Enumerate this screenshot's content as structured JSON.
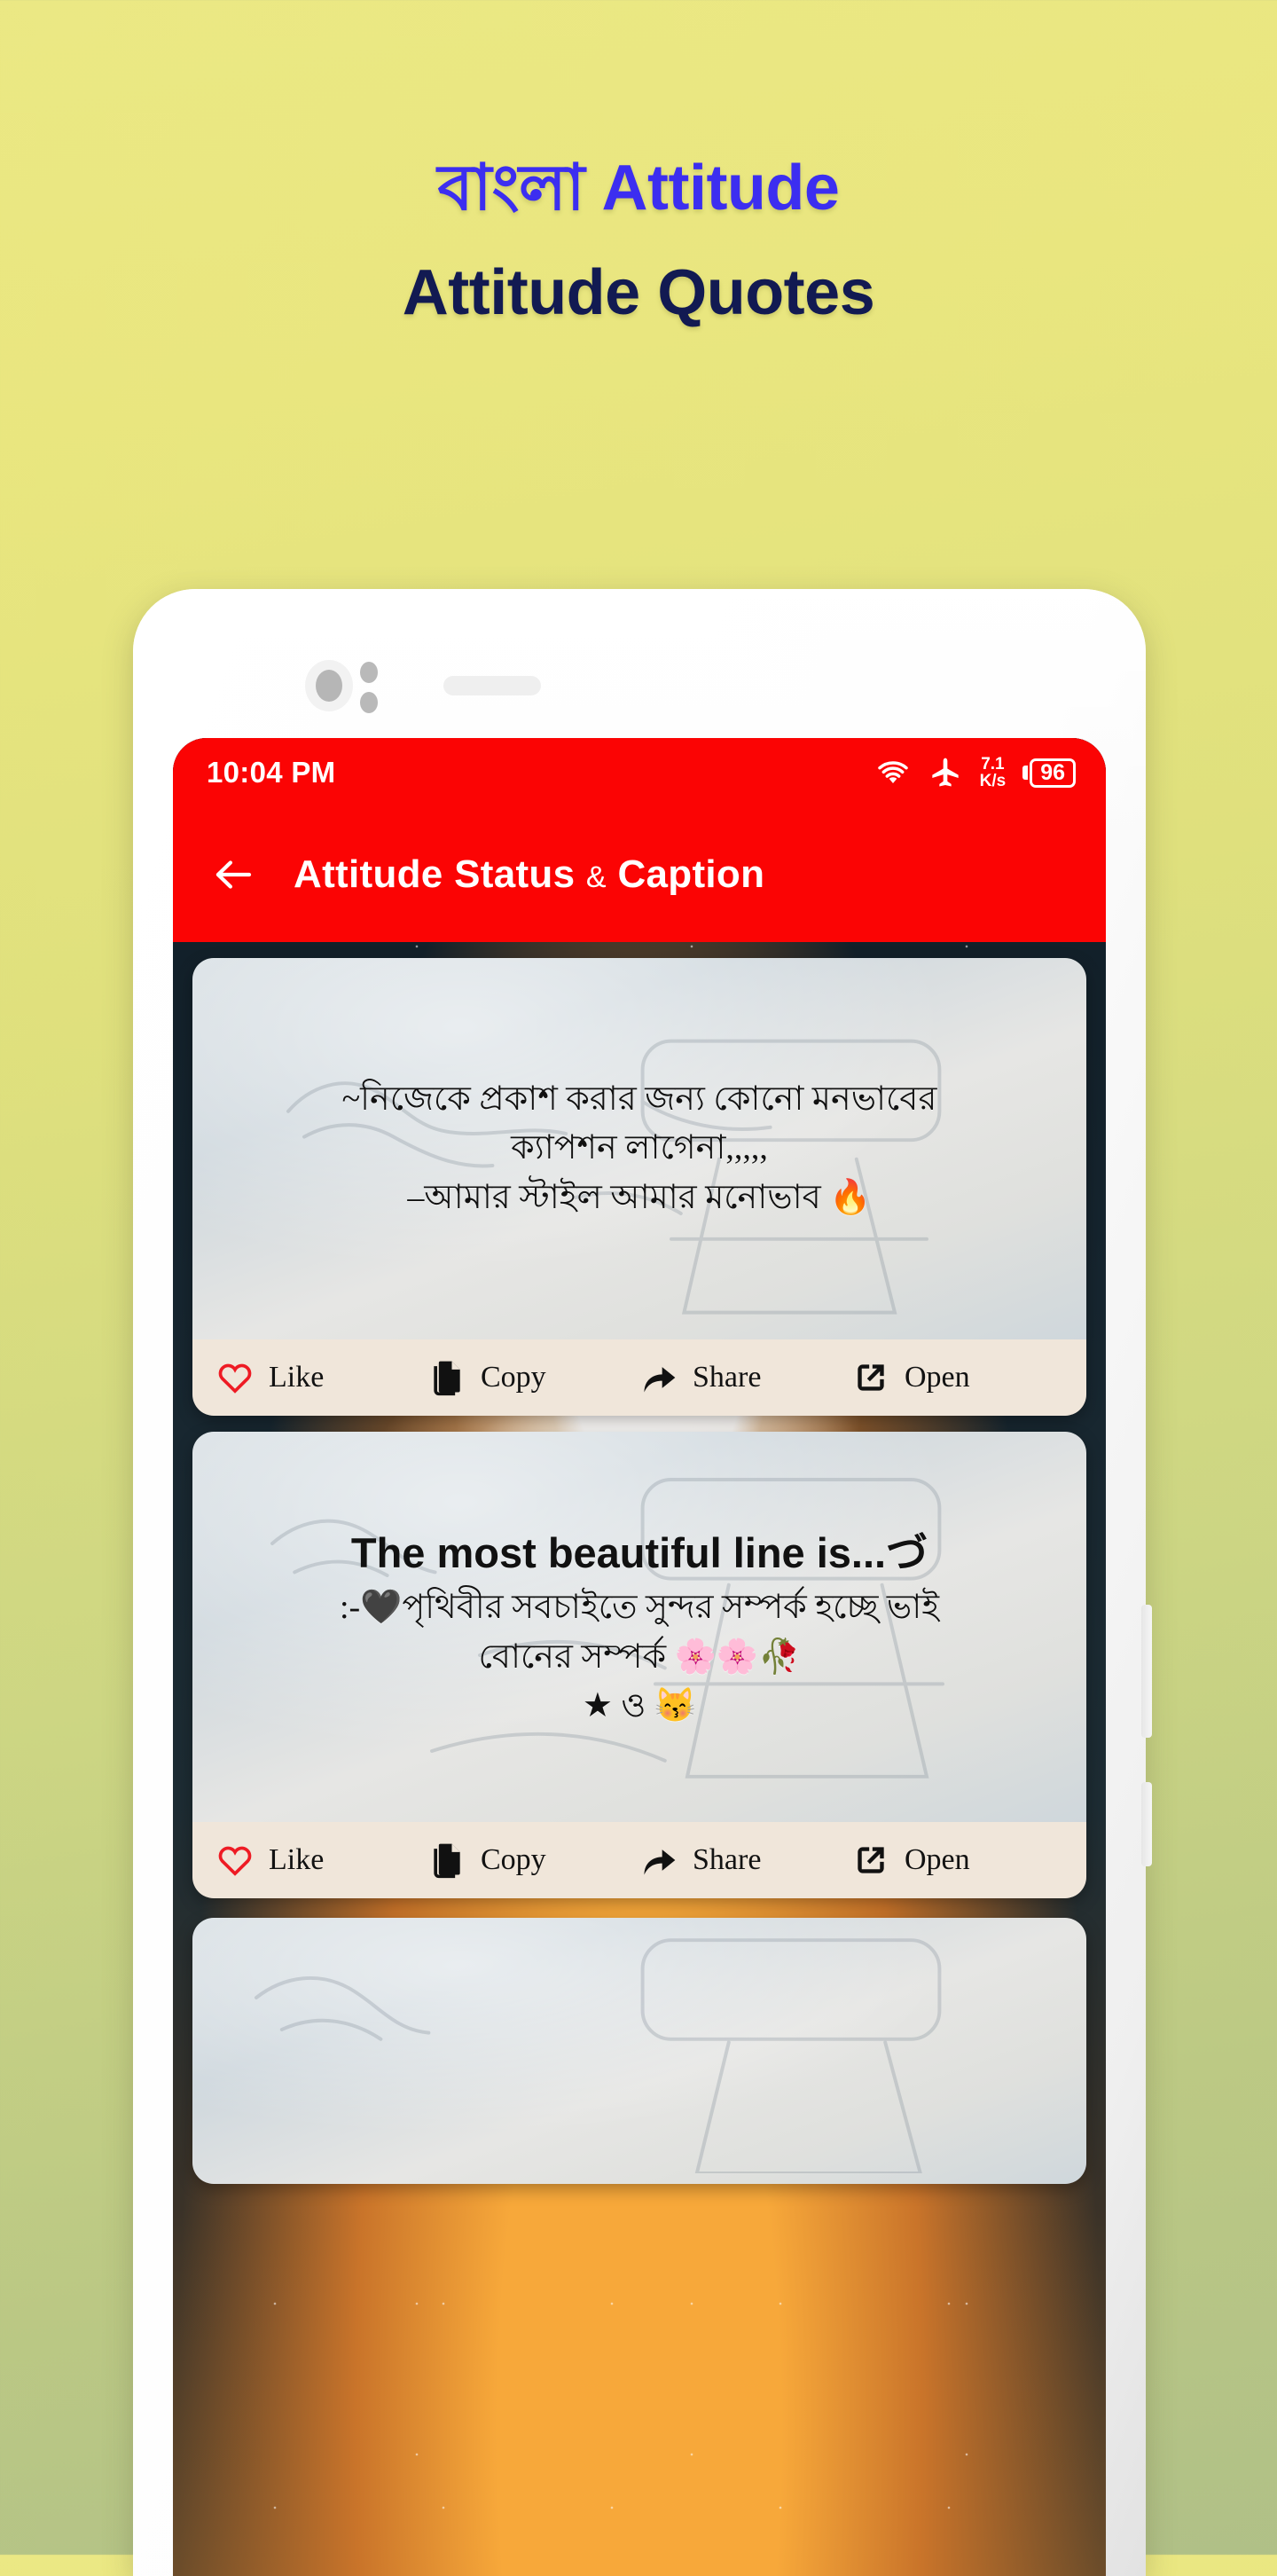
{
  "promo": {
    "line1": "বাংলা Attitude",
    "line2": "Attitude Quotes",
    "line1_color": "#3c2ef0",
    "line2_color": "#121a52",
    "bg_top": "#e9e67f",
    "bg_bottom": "#b0c087"
  },
  "statusbar": {
    "time": "10:04 PM",
    "wifi_icon": "wifi-icon",
    "airplane_icon": "airplane-mode-icon",
    "net_speed_value": "7.1",
    "net_speed_unit": "K/s",
    "battery_percent": "96",
    "bg_color": "#fb0404"
  },
  "appbar": {
    "back_icon": "back-arrow-icon",
    "title_main": "Attitude Status",
    "title_amp": "&",
    "title_tail": "Caption",
    "bg_color": "#fb0404",
    "text_color": "#ffffff"
  },
  "actions": {
    "like": "Like",
    "copy": "Copy",
    "share": "Share",
    "open": "Open",
    "like_icon_color": "#ee1b24",
    "bar_bg": "#f0e6da"
  },
  "cards": [
    {
      "lines": [
        "~নিজেকে প্রকাশ করার জন্য কোনো মনভাবের",
        "ক্যাপশন লাগেনা,,,,,",
        "–আমার স্টাইল আমার মনোভাব 🔥"
      ]
    },
    {
      "heading": "The most beautiful line is...づ",
      "lines": [
        ":-🖤পৃথিবীর সবচাইতে সুন্দর সম্পর্ক হচ্ছে ভাই",
        "বোনের সম্পর্ক 🌸🌸🥀",
        "★ ও 😽"
      ]
    },
    {
      "lines": []
    }
  ]
}
